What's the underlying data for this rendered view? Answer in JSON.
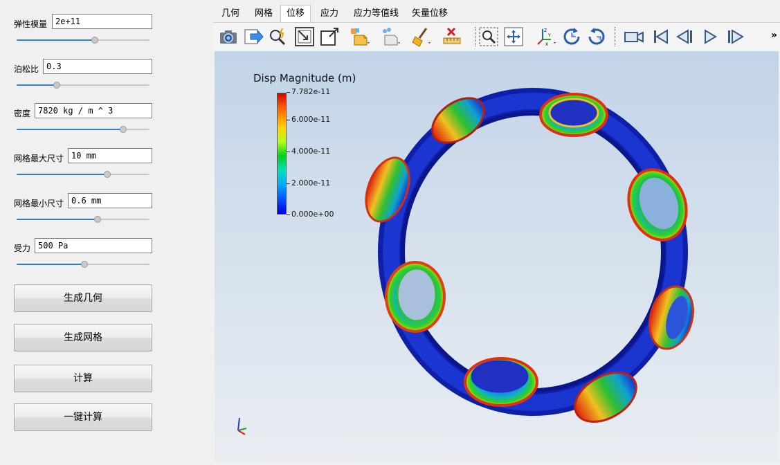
{
  "params": [
    {
      "label": "弹性模量",
      "value": "2e+11",
      "slider": 0.59
    },
    {
      "label": "泊松比",
      "value": "0.3",
      "slider": 0.3
    },
    {
      "label": "密度",
      "value": "7820 kg / m ^ 3",
      "slider": 0.8
    },
    {
      "label": "网格最大尺寸",
      "value": "10 mm",
      "slider": 0.68
    },
    {
      "label": "网格最小尺寸",
      "value": "0.6 mm",
      "slider": 0.61
    },
    {
      "label": "受力",
      "value": "500 Pa",
      "slider": 0.51
    }
  ],
  "buttons": {
    "gen_geometry": "生成几何",
    "gen_mesh": "生成网格",
    "compute": "计算",
    "one_click": "一键计算"
  },
  "tabs": [
    "几何",
    "网格",
    "位移",
    "应力",
    "应力等值线",
    "矢量位移"
  ],
  "active_tab": "位移",
  "toolbar": {
    "icons": [
      "camera-icon",
      "export-icon",
      "zoom-pick-icon",
      "reset-camera-icon",
      "zoom-box-icon",
      "surface-icon",
      "points-icon",
      "clear-icon",
      "ruler-icon",
      "zoom-region-icon",
      "pan-icon",
      "axes-icon",
      "rotate-cw-icon",
      "rotate-ccw-icon",
      "record-icon",
      "first-frame-icon",
      "prev-frame-icon",
      "next-frame-icon",
      "last-frame-icon"
    ],
    "more": "»"
  },
  "legend": {
    "title": "Disp Magnitude (m)",
    "ticks": [
      "7.782e-11",
      "6.000e-11",
      "4.000e-11",
      "2.000e-11",
      "0.000e+00"
    ]
  },
  "colors": {
    "slider_fill": "#3a7ac6",
    "ring_blue": "#1428c8"
  }
}
